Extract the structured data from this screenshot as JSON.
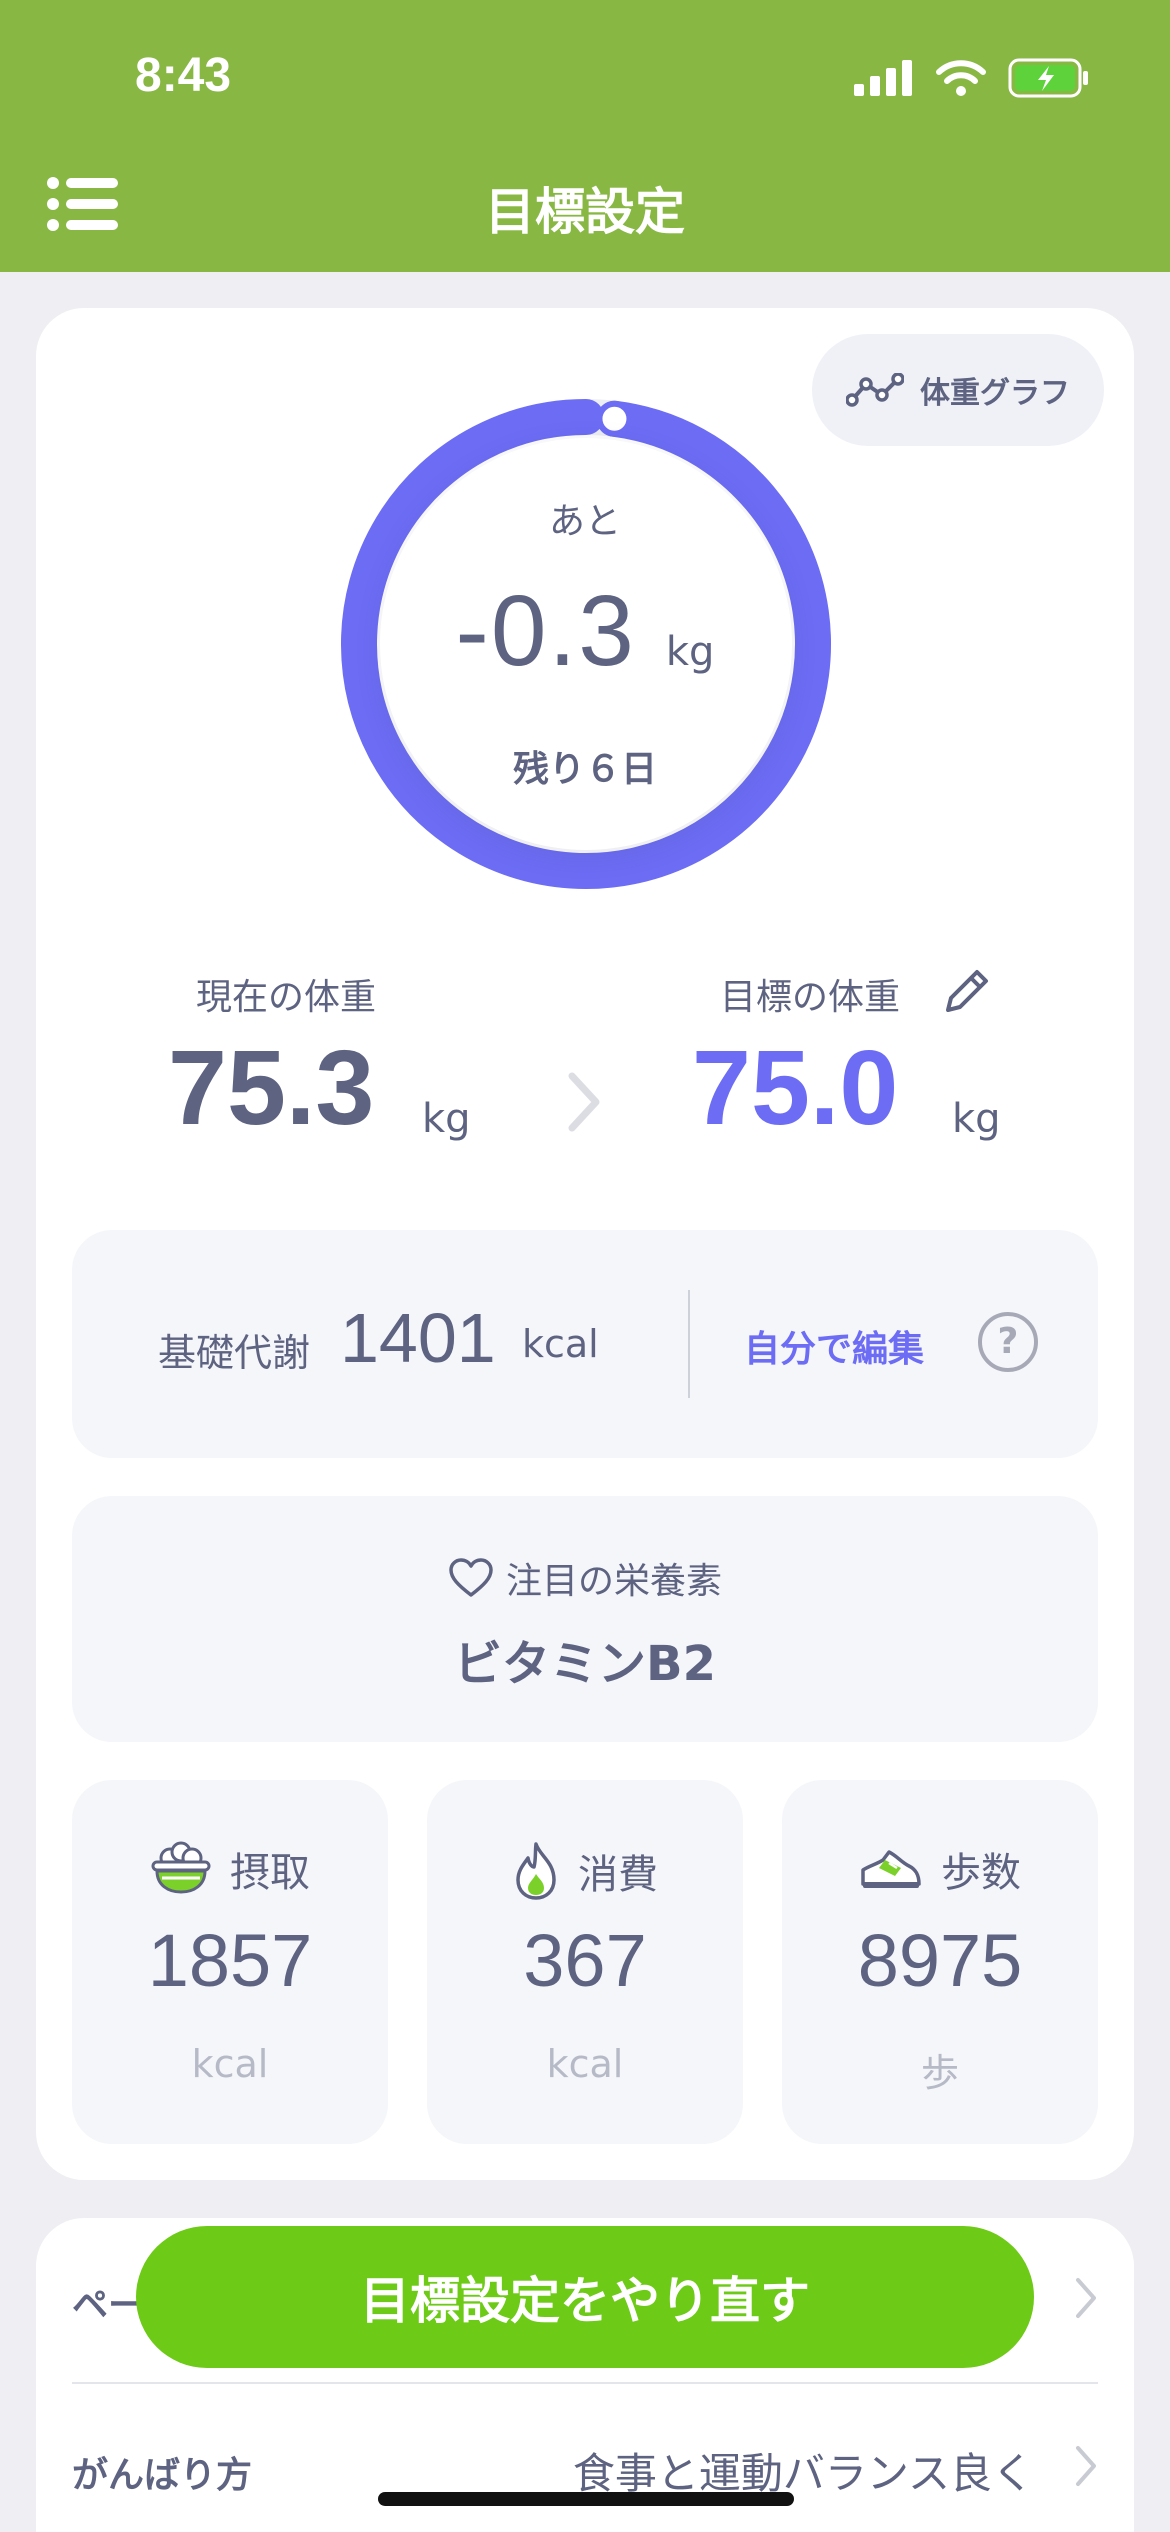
{
  "status": {
    "time": "8:43"
  },
  "nav": {
    "title": "目標設定"
  },
  "card": {
    "graph_button": "体重グラフ",
    "ring": {
      "label": "あと",
      "value": "-0.3",
      "unit": "kg",
      "remaining": "残り６日",
      "progress_fraction": 0.98
    },
    "current": {
      "label": "現在の体重",
      "value": "75.3",
      "unit": "kg"
    },
    "target": {
      "label": "目標の体重",
      "value": "75.0",
      "unit": "kg"
    },
    "bmr": {
      "label": "基礎代謝",
      "value": "1401",
      "unit": "kcal",
      "edit": "自分で編集",
      "help": "?"
    },
    "nutrient": {
      "label": "注目の栄養素",
      "value": "ビタミンB2"
    },
    "stats": [
      {
        "label": "摂取",
        "value": "1857",
        "unit": "kcal",
        "icon": "rice-bowl-icon"
      },
      {
        "label": "消費",
        "value": "367",
        "unit": "kcal",
        "icon": "flame-icon"
      },
      {
        "label": "歩数",
        "value": "8975",
        "unit": "歩",
        "icon": "sneaker-icon"
      }
    ]
  },
  "settings": {
    "row1_label": "ペー",
    "row2_label": "がんばり方",
    "row2_value": "食事と運動バランス良く"
  },
  "cta": "目標設定をやり直す",
  "colors": {
    "header": "#88b843",
    "accent": "#6c6cf5",
    "cta": "#6dca16",
    "text": "#5d6380"
  }
}
